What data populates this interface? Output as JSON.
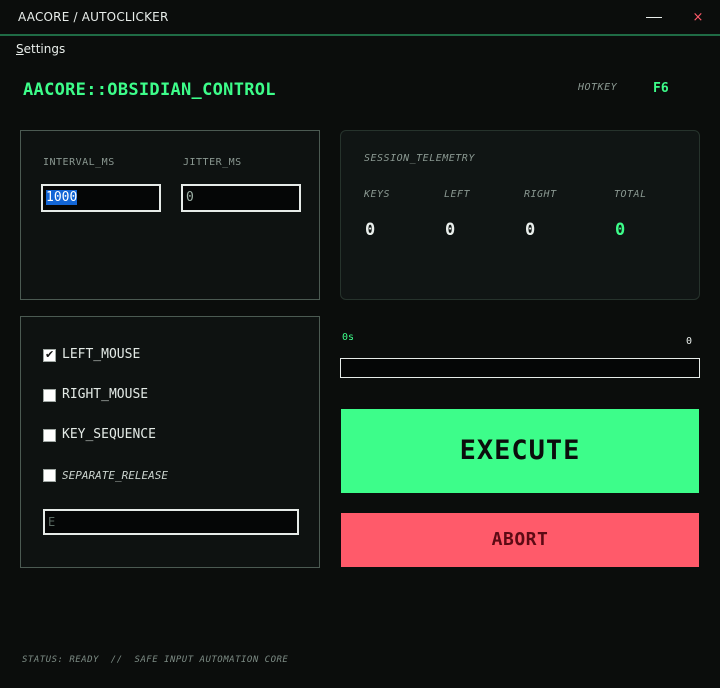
{
  "window": {
    "title": "AACORE / AUTOCLICKER",
    "minimize_icon": "minimize-icon",
    "close_icon": "close-icon",
    "close_glyph": "×"
  },
  "menu": {
    "items": [
      {
        "label": "Settings"
      }
    ]
  },
  "header": {
    "title": "AACORE::OBSIDIAN_CONTROL",
    "hotkey_label": "HOTKEY",
    "hotkey_value": "F6"
  },
  "timing": {
    "interval_label": "INTERVAL_MS",
    "interval_value": "1000",
    "jitter_label": "JITTER_MS",
    "jitter_value": "0"
  },
  "telemetry": {
    "title": "SESSION_TELEMETRY",
    "columns": [
      {
        "label": "KEYS",
        "value": "0"
      },
      {
        "label": "LEFT",
        "value": "0"
      },
      {
        "label": "RIGHT",
        "value": "0"
      },
      {
        "label": "TOTAL",
        "value": "0"
      }
    ]
  },
  "options": {
    "checkboxes": [
      {
        "label": "LEFT_MOUSE",
        "checked": true
      },
      {
        "label": "RIGHT_MOUSE",
        "checked": false
      },
      {
        "label": "KEY_SEQUENCE",
        "checked": false
      },
      {
        "label": "SEPARATE_RELEASE",
        "checked": false
      }
    ],
    "key_input_value": "E"
  },
  "progress": {
    "elapsed": "0s",
    "count": "0",
    "fraction": 0
  },
  "actions": {
    "execute_label": "EXECUTE",
    "abort_label": "ABORT"
  },
  "status": {
    "text": "STATUS: READY  //  SAFE INPUT AUTOMATION CORE"
  },
  "colors": {
    "accent": "#3dfd8a",
    "danger": "#ff5a6a",
    "background": "#0b0d0c",
    "selection": "#1366d6"
  }
}
